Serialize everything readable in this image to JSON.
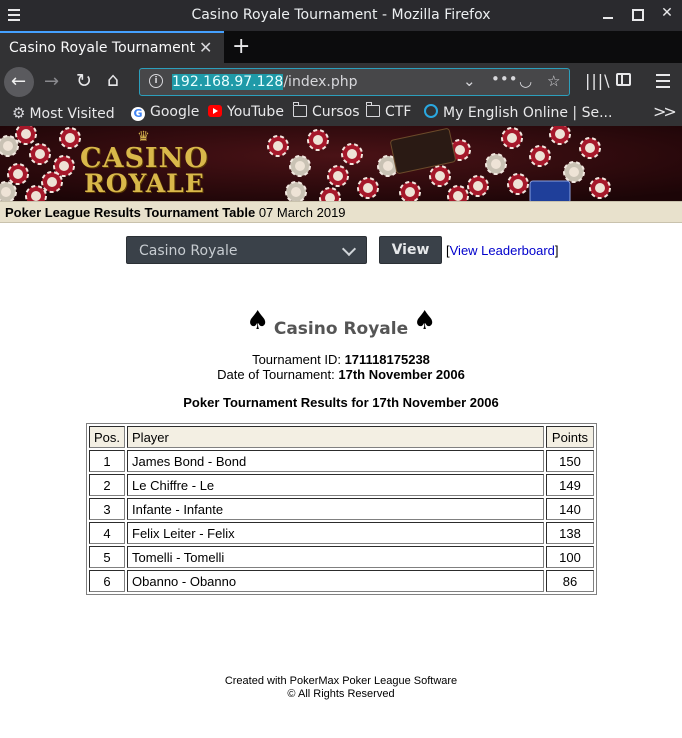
{
  "window": {
    "title": "Casino Royale Tournament - Mozilla Firefox"
  },
  "tab": {
    "label": "Casino Royale Tournament"
  },
  "urlbar": {
    "host": "192.168.97.128",
    "path": "/index.php"
  },
  "bookmarks": [
    {
      "label": "Most Visited",
      "icon": "gear-icon"
    },
    {
      "label": "Google",
      "icon": "google-icon"
    },
    {
      "label": "YouTube",
      "icon": "youtube-icon"
    },
    {
      "label": "Cursos",
      "icon": "folder-icon"
    },
    {
      "label": "CTF",
      "icon": "folder-icon"
    },
    {
      "label": "My English Online | Se...",
      "icon": "globe-icon"
    }
  ],
  "banner": {
    "logo_line1": "CASINO",
    "logo_line2": "ROYALE"
  },
  "header": {
    "title": "Poker League Results Tournament Table",
    "date": "07 March 2019"
  },
  "controls": {
    "selected_tournament": "Casino Royale",
    "view_label": "View",
    "leaderboard_label": "View Leaderboard"
  },
  "tournament": {
    "name": "Casino Royale",
    "id_label": "Tournament ID:",
    "id": "171118175238",
    "date_label": "Date of Tournament:",
    "date": "17th November 2006",
    "results_title": "Poker Tournament Results for 17th November 2006"
  },
  "table": {
    "headers": {
      "pos": "Pos.",
      "player": "Player",
      "points": "Points"
    },
    "rows": [
      {
        "pos": "1",
        "player": "James Bond - Bond",
        "points": "150"
      },
      {
        "pos": "2",
        "player": "Le Chiffre - Le",
        "points": "149"
      },
      {
        "pos": "3",
        "player": "Infante - Infante",
        "points": "140"
      },
      {
        "pos": "4",
        "player": "Felix Leiter - Felix",
        "points": "138"
      },
      {
        "pos": "5",
        "player": "Tomelli - Tomelli",
        "points": "100"
      },
      {
        "pos": "6",
        "player": "Obanno - Obanno",
        "points": "86"
      }
    ]
  },
  "footer": {
    "line1": "Created with PokerMax Poker League Software",
    "line2": "© All Rights Reserved"
  },
  "colors": {
    "accent": "#45a1ff",
    "banner_bg": "#2b0a0d",
    "header_bar": "#e8e1cc",
    "link": "#0000cc"
  }
}
